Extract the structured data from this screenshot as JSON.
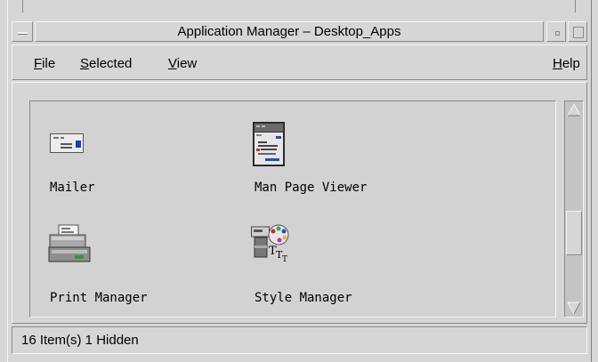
{
  "window": {
    "title": "Application Manager – Desktop_Apps"
  },
  "menubar": {
    "file": {
      "mnemonic": "F",
      "rest": "ile"
    },
    "selected": {
      "mnemonic": "S",
      "rest": "elected"
    },
    "view": {
      "mnemonic": "V",
      "rest": "iew"
    },
    "help": {
      "mnemonic": "H",
      "rest": "elp"
    }
  },
  "apps": [
    {
      "label": "Mailer",
      "icon": "mailer-icon"
    },
    {
      "label": "Man Page Viewer",
      "icon": "man-page-viewer-icon"
    },
    {
      "label": "Print Manager",
      "icon": "print-manager-icon"
    },
    {
      "label": "Style Manager",
      "icon": "style-manager-icon"
    }
  ],
  "status": {
    "text": "16 Item(s) 1 Hidden"
  },
  "colors": {
    "window_bg": "#d6d6d6",
    "icon_area_bg": "#d2d2d2",
    "scroll_trough": "#c4c4c4"
  }
}
